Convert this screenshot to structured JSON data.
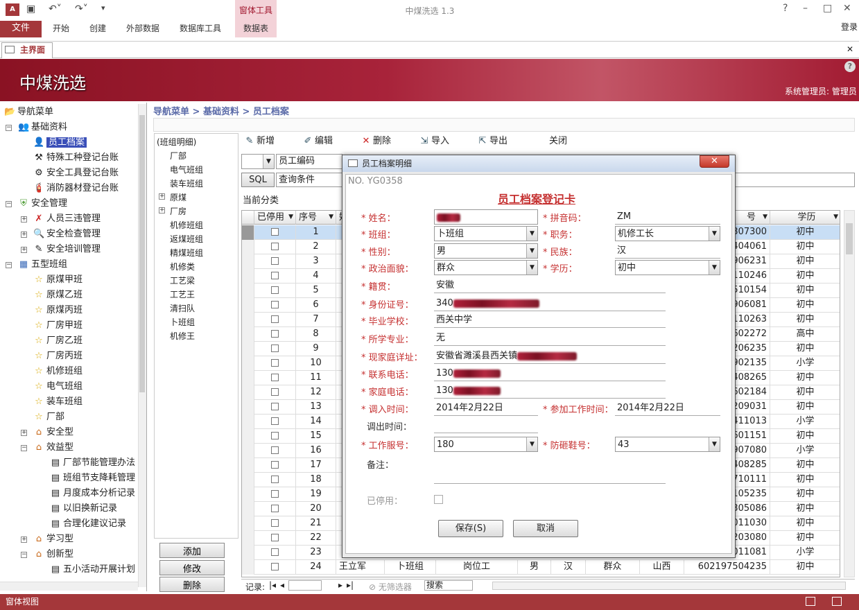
{
  "window": {
    "app_title": "中煤洗选 1.3",
    "context_group": "窗体工具",
    "login": "登录"
  },
  "ribbon": {
    "tabs": [
      "文件",
      "开始",
      "创建",
      "外部数据",
      "数据库工具",
      "数据表"
    ]
  },
  "doc_tab": "主界面",
  "banner": {
    "title": "中煤洗选",
    "admin": "系统管理员: 管理员"
  },
  "nav": {
    "root": "导航菜单",
    "items": [
      {
        "label": "基础资料",
        "icon": "people-icon",
        "level": 1
      },
      {
        "label": "员工档案",
        "icon": "employee-icon",
        "level": 2,
        "selected": true
      },
      {
        "label": "特殊工种登记台账",
        "icon": "worker-icon",
        "level": 2
      },
      {
        "label": "安全工具登记台账",
        "icon": "tools-icon",
        "level": 2
      },
      {
        "label": "消防器材登记台账",
        "icon": "extinguisher-icon",
        "level": 2
      },
      {
        "label": "安全管理",
        "icon": "shield-icon",
        "level": 1
      },
      {
        "label": "人员三违管理",
        "icon": "cross-icon",
        "level": 2
      },
      {
        "label": "安全检查管理",
        "icon": "magnifier-icon",
        "level": 2
      },
      {
        "label": "安全培训管理",
        "icon": "training-icon",
        "level": 2
      },
      {
        "label": "五型班组",
        "icon": "chart-icon",
        "level": 1
      },
      {
        "label": "原煤甲班",
        "icon": "star-icon",
        "level": 2
      },
      {
        "label": "原煤乙班",
        "icon": "star-icon",
        "level": 2
      },
      {
        "label": "原煤丙班",
        "icon": "star-icon",
        "level": 2
      },
      {
        "label": "厂房甲班",
        "icon": "star-icon",
        "level": 2
      },
      {
        "label": "厂房乙班",
        "icon": "star-icon",
        "level": 2
      },
      {
        "label": "厂房丙班",
        "icon": "star-icon",
        "level": 2
      },
      {
        "label": "机修班组",
        "icon": "star-icon",
        "level": 2
      },
      {
        "label": "电气班组",
        "icon": "star-icon",
        "level": 2
      },
      {
        "label": "装车班组",
        "icon": "star-icon",
        "level": 2
      },
      {
        "label": "厂部",
        "icon": "star-icon",
        "level": 2
      },
      {
        "label": "安全型",
        "icon": "house-icon",
        "level": 2
      },
      {
        "label": "效益型",
        "icon": "house-icon",
        "level": 2
      },
      {
        "label": "厂部节能管理办法",
        "icon": "doc-icon",
        "level": 3
      },
      {
        "label": "班组节支降耗管理",
        "icon": "doc-icon",
        "level": 3
      },
      {
        "label": "月度成本分析记录",
        "icon": "doc-icon",
        "level": 3
      },
      {
        "label": "以旧换新记录",
        "icon": "doc-icon",
        "level": 3
      },
      {
        "label": "合理化建议记录",
        "icon": "doc-icon",
        "level": 3
      },
      {
        "label": "学习型",
        "icon": "house-icon",
        "level": 2
      },
      {
        "label": "创新型",
        "icon": "house-icon",
        "level": 2
      },
      {
        "label": "五小活动开展计划",
        "icon": "doc-icon",
        "level": 3
      }
    ]
  },
  "breadcrumb": "导航菜单 > 基础资料 > 员工档案",
  "categories": [
    "(班组明细)",
    "厂部",
    "电气班组",
    "装车班组",
    "原煤",
    "厂房",
    "机修班组",
    "返煤班组",
    "精煤班组",
    "机修类",
    "工艺梁",
    "工艺王",
    "清扫队",
    "卜班组",
    "机修王"
  ],
  "left_buttons": [
    "添加",
    "修改",
    "删除"
  ],
  "toolbar": {
    "new": "新增",
    "edit": "编辑",
    "delete": "删除",
    "import": "导入",
    "export": "导出",
    "close": "关闭"
  },
  "filter": {
    "field": "员工编码",
    "sql": "SQL",
    "condition": "查询条件",
    "current": "当前分类"
  },
  "grid": {
    "headers": {
      "disabled": "已停用",
      "seq": "序号",
      "c3": "姓",
      "idtail": "号",
      "edu": "学历"
    },
    "rows": [
      {
        "seq": "1",
        "id": "307300",
        "edu": "初中"
      },
      {
        "seq": "2",
        "id": "404061",
        "edu": "初中"
      },
      {
        "seq": "3",
        "id": "906231",
        "edu": "初中"
      },
      {
        "seq": "4",
        "id": "110246",
        "edu": "初中"
      },
      {
        "seq": "5",
        "id": "510154",
        "edu": "初中"
      },
      {
        "seq": "6",
        "id": "906081",
        "edu": "初中"
      },
      {
        "seq": "7",
        "id": "110263",
        "edu": "初中"
      },
      {
        "seq": "8",
        "id": "602272",
        "edu": "高中"
      },
      {
        "seq": "9",
        "id": "206235",
        "edu": "初中"
      },
      {
        "seq": "10",
        "id": "902135",
        "edu": "小学"
      },
      {
        "seq": "11",
        "id": "408265",
        "edu": "初中"
      },
      {
        "seq": "12",
        "id": "602184",
        "edu": "初中"
      },
      {
        "seq": "13",
        "id": "209031",
        "edu": "初中"
      },
      {
        "seq": "14",
        "id": "411013",
        "edu": "小学"
      },
      {
        "seq": "15",
        "id": "601151",
        "edu": "初中"
      },
      {
        "seq": "16",
        "id": "907080",
        "edu": "小学"
      },
      {
        "seq": "17",
        "id": "408285",
        "edu": "初中"
      },
      {
        "seq": "18",
        "id": "710111",
        "edu": "初中"
      },
      {
        "seq": "19",
        "id": "105235",
        "edu": "初中"
      },
      {
        "seq": "20",
        "id": "305086",
        "edu": "初中"
      },
      {
        "seq": "21",
        "id": "011030",
        "edu": "初中"
      },
      {
        "seq": "22",
        "id": "203080",
        "edu": "初中"
      },
      {
        "seq": "23",
        "id": "011081",
        "edu": "小学"
      }
    ],
    "row24": {
      "seq": "24",
      "name": "王立军",
      "team": "卜班组",
      "post": "岗位工",
      "sex": "男",
      "nation": "汉",
      "politics": "群众",
      "origin": "山西",
      "id": "602197504235",
      "edu": "初中"
    }
  },
  "recnav": {
    "label": "记录:",
    "nofilter": "无筛选器",
    "search": "搜索"
  },
  "status": "窗体视图",
  "modal": {
    "title": "员工档案明细",
    "record_no": "NO.  YG0358",
    "card_title": "员工档案登记卡",
    "fields": {
      "name_label": "* 姓名：",
      "name": "",
      "pinyin_label": "* 拼音码：",
      "pinyin": "ZM",
      "team_label": "* 班组：",
      "team": "卜班组",
      "duty_label": "* 职务：",
      "duty": "机修工长",
      "sex_label": "* 性别：",
      "sex": "男",
      "nation_label": "* 民族：",
      "nation": "汉",
      "politics_label": "* 政治面貌：",
      "politics": "群众",
      "edu_label": "* 学历：",
      "edu": "初中",
      "origin_label": "* 籍贯：",
      "origin": "安徽",
      "idcard_label": "* 身份证号：",
      "idcard": "340",
      "school_label": "* 毕业学校：",
      "school": "西关中学",
      "major_label": "* 所学专业：",
      "major": "无",
      "address_label": "* 现家庭详址：",
      "address": "安徽省濉溪县西关镇",
      "phone_label": "* 联系电话：",
      "phone": "130",
      "homephone_label": "* 家庭电话：",
      "homephone": "130",
      "in_label": "* 调入时间：",
      "in_date": "2014年2月22日",
      "work_label": "* 参加工作时间：",
      "work_date": "2014年2月22日",
      "out_label": "调出时间：",
      "uniform_label": "* 工作服号：",
      "uniform": "180",
      "shoe_label": "* 防砸鞋号：",
      "shoe": "43",
      "note_label": "备注：",
      "disabled_label": "已停用："
    },
    "save": "保存(S)",
    "cancel": "取消"
  }
}
